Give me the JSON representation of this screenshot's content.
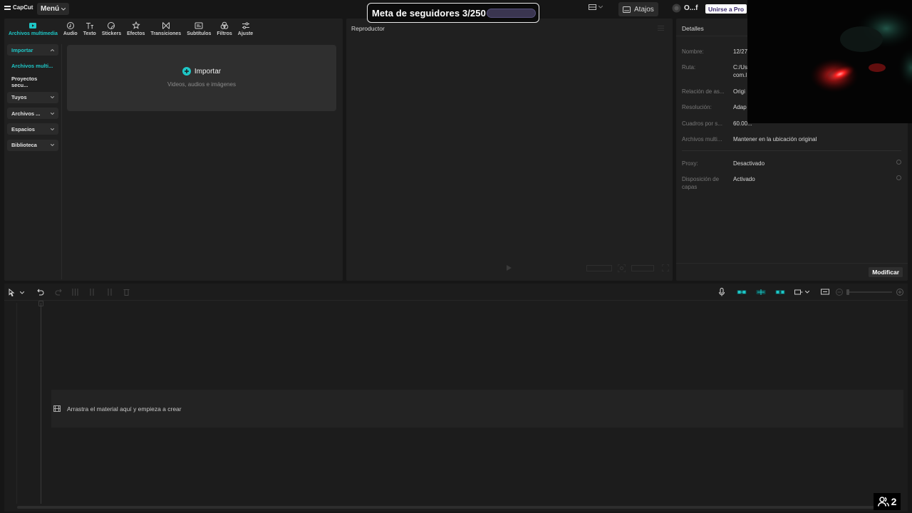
{
  "app": {
    "logo_text": "CapCut",
    "menu_label": "Menú",
    "shortcuts_label": "Atajos",
    "user_label": "O...f",
    "pro_label": "Unirse a Pro"
  },
  "overlay": {
    "follower_goal": "Meta de seguidores 3/250",
    "viewer_count": "2"
  },
  "toolbar": {
    "tabs": [
      {
        "label": "Archivos multimedia",
        "icon": "media-icon",
        "active": true
      },
      {
        "label": "Audio",
        "icon": "audio-icon"
      },
      {
        "label": "Texto",
        "icon": "text-icon"
      },
      {
        "label": "Stickers",
        "icon": "sticker-icon"
      },
      {
        "label": "Efectos",
        "icon": "effects-icon"
      },
      {
        "label": "Transiciones",
        "icon": "transitions-icon"
      },
      {
        "label": "Subtítulos",
        "icon": "subtitles-icon"
      },
      {
        "label": "Filtros",
        "icon": "filters-icon"
      },
      {
        "label": "Ajuste",
        "icon": "adjust-icon"
      }
    ]
  },
  "sidebar": {
    "items": [
      {
        "label": "Importar"
      },
      {
        "label": "Archivos multi..."
      },
      {
        "label": "Proyectos secu..."
      },
      {
        "label": "Tuyos"
      },
      {
        "label": "Archivos ..."
      },
      {
        "label": "Espacios"
      },
      {
        "label": "Biblioteca"
      }
    ]
  },
  "media": {
    "import_label": "Importar",
    "import_sub": "Videos, audios e imágenes"
  },
  "player": {
    "title": "Reproductor"
  },
  "details": {
    "title": "Detalles",
    "rows": [
      {
        "label": "Nombre:",
        "value": "12/27"
      },
      {
        "label": "Ruta:",
        "value": "C:/Us com.l"
      },
      {
        "label": "Relación de as...",
        "value": "Origi"
      },
      {
        "label": "Resolución:",
        "value": "Adap"
      },
      {
        "label": "Cuadros por s...",
        "value": "60.00..."
      },
      {
        "label": "Archivos multi...",
        "value": "Mantener en la ubicación original"
      },
      {
        "label": "Proxy:",
        "value": "Desactivado"
      },
      {
        "label": "Disposición de capas",
        "value": "Activado"
      }
    ],
    "modify_label": "Modificar"
  },
  "timeline": {
    "drop_hint": "Arrastra el material aquí y empieza a crear"
  },
  "colors": {
    "accent": "#1ec7c7",
    "panel": "#202020",
    "background": "#161616"
  }
}
